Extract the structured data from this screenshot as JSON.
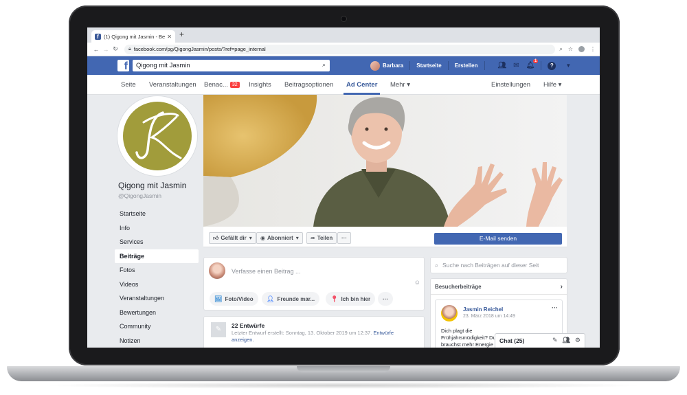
{
  "browser": {
    "tab_title": "(1) Qigong mit Jasmin - Beitr...",
    "url": "facebook.com/pg/QigongJasmin/posts/?ref=page_internal"
  },
  "fb_header": {
    "search_value": "Qigong mit Jasmin",
    "user_name": "Barbara",
    "home_label": "Startseite",
    "create_label": "Erstellen",
    "notification_count": "1"
  },
  "page_tabs": {
    "items": [
      "Seite",
      "Veranstaltungen",
      "Benac...",
      "Insights",
      "Beitragsoptionen",
      "Ad Center",
      "Mehr ▾"
    ],
    "notifications_badge": "32",
    "settings": "Einstellungen",
    "help": "Hilfe ▾"
  },
  "page": {
    "name": "Qigong mit Jasmin",
    "handle": "@QigongJasmin",
    "nav": [
      "Startseite",
      "Info",
      "Services",
      "Beiträge",
      "Fotos",
      "Videos",
      "Veranstaltungen",
      "Bewertungen",
      "Community",
      "Notizen"
    ],
    "active_nav": "Beiträge"
  },
  "actions": {
    "like": "Gefällt dir",
    "subscribed": "Abonniert",
    "share": "Teilen",
    "more": "···",
    "email": "E-Mail senden"
  },
  "composer": {
    "placeholder": "Verfasse einen Beitrag ...",
    "photo_video": "Foto/Video",
    "tag_friends": "Freunde mar...",
    "checkin": "Ich bin hier",
    "more": "···"
  },
  "drafts": {
    "title": "22 Entwürfe",
    "subtitle": "Letzter Entwurf erstellt: Sonntag, 13. Oktober 2019 um 12:37.",
    "link": "Entwürfe anzeigen."
  },
  "right": {
    "search_placeholder": "Suche nach Beiträgen auf dieser Seit",
    "visitor_header": "Besucherbeiträge",
    "visitor_post": {
      "author": "Jasmin Reichel",
      "date": "23. März 2018 um 14:49",
      "text": "Dich plagt die Frühjahrsmüdigkeit? Du brauchst mehr Energie ... deutlich mehr Energie"
    }
  },
  "chat": {
    "label": "Chat (25)"
  },
  "colors": {
    "fb_blue": "#4267b2",
    "link": "#365899",
    "logo_olive": "#a19c3b",
    "badge_red": "#fa3e3e"
  }
}
